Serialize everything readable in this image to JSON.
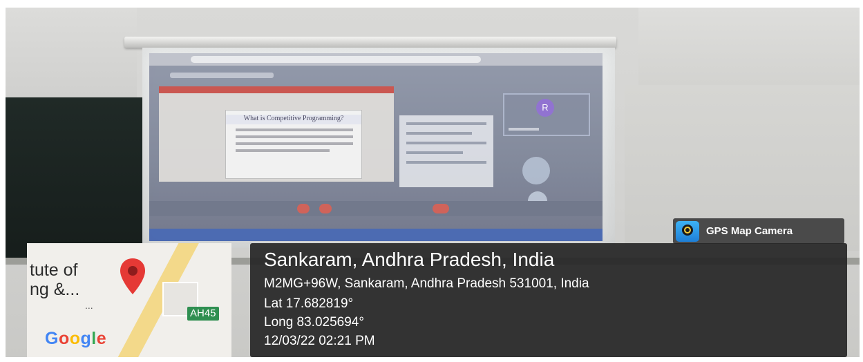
{
  "overlay": {
    "app_name": "GPS Map Camera",
    "icon": "gps-map-camera-icon",
    "location_title": "Sankaram, Andhra Pradesh, India",
    "address": "M2MG+96W, Sankaram, Andhra Pradesh 531001, India",
    "latitude": "Lat 17.682819°",
    "longitude": "Long 83.025694°",
    "datetime": "12/03/22 02:21 PM"
  },
  "map": {
    "label_line1": "tute of",
    "label_line2": "ng &...",
    "ellipsis": "...",
    "route_tag": "AH45",
    "google_letters": [
      "G",
      "o",
      "o",
      "g",
      "l",
      "e"
    ],
    "google_colors": [
      "#4285F4",
      "#EA4335",
      "#FBBC05",
      "#4285F4",
      "#34A853",
      "#EA4335"
    ],
    "pin_color": "#E53935"
  },
  "projection": {
    "avatar_letter": "R",
    "slide_title": "What is Competitive Programming?"
  }
}
